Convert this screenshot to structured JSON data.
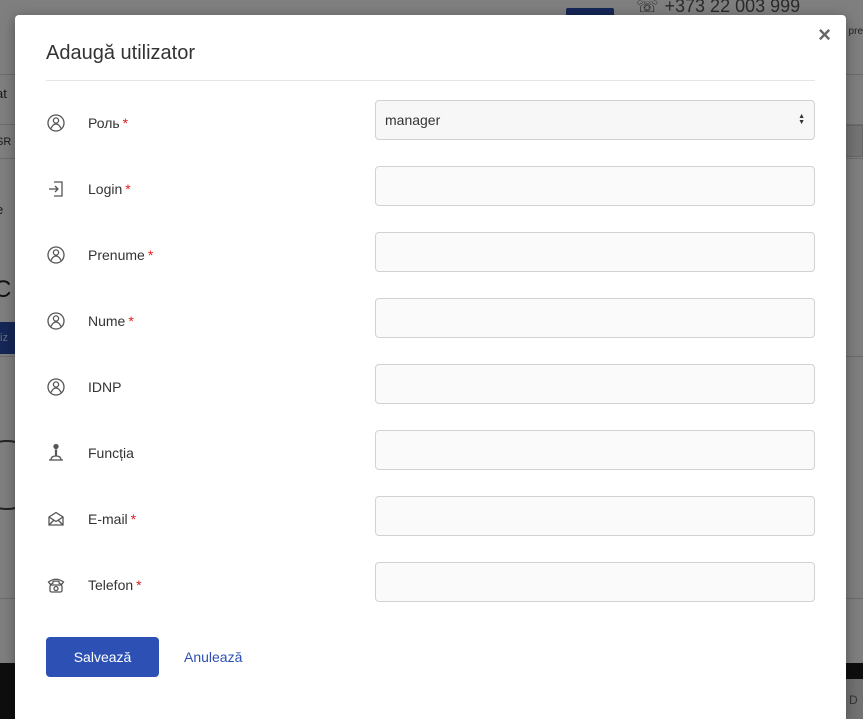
{
  "background": {
    "phone": "+373 22 003 999",
    "left_fragments": [
      "at",
      "SR",
      "e",
      "C",
      "iz"
    ],
    "right_fragments": [
      "pre",
      "CO"
    ],
    "footer_button": "D"
  },
  "modal": {
    "title": "Adaugă utilizator",
    "close_glyph": "×",
    "required_marker": "*",
    "fields": {
      "role": {
        "label": "Роль",
        "value": "manager",
        "icon": "user-icon"
      },
      "login": {
        "label": "Login",
        "value": "",
        "icon": "login-icon"
      },
      "prenume": {
        "label": "Prenume",
        "value": "",
        "icon": "user-icon"
      },
      "nume": {
        "label": "Nume",
        "value": "",
        "icon": "user-icon"
      },
      "idnp": {
        "label": "IDNP",
        "value": "",
        "icon": "user-icon"
      },
      "functia": {
        "label": "Funcția",
        "value": "",
        "icon": "job-icon"
      },
      "email": {
        "label": "E-mail",
        "value": "",
        "icon": "envelope-icon"
      },
      "telefon": {
        "label": "Telefon",
        "value": "",
        "icon": "phone-icon"
      }
    },
    "save_label": "Salvează",
    "cancel_label": "Anulează"
  },
  "colors": {
    "primary": "#2c50b4",
    "required": "#e02020",
    "overlay": "rgba(0,0,0,0.5)"
  }
}
